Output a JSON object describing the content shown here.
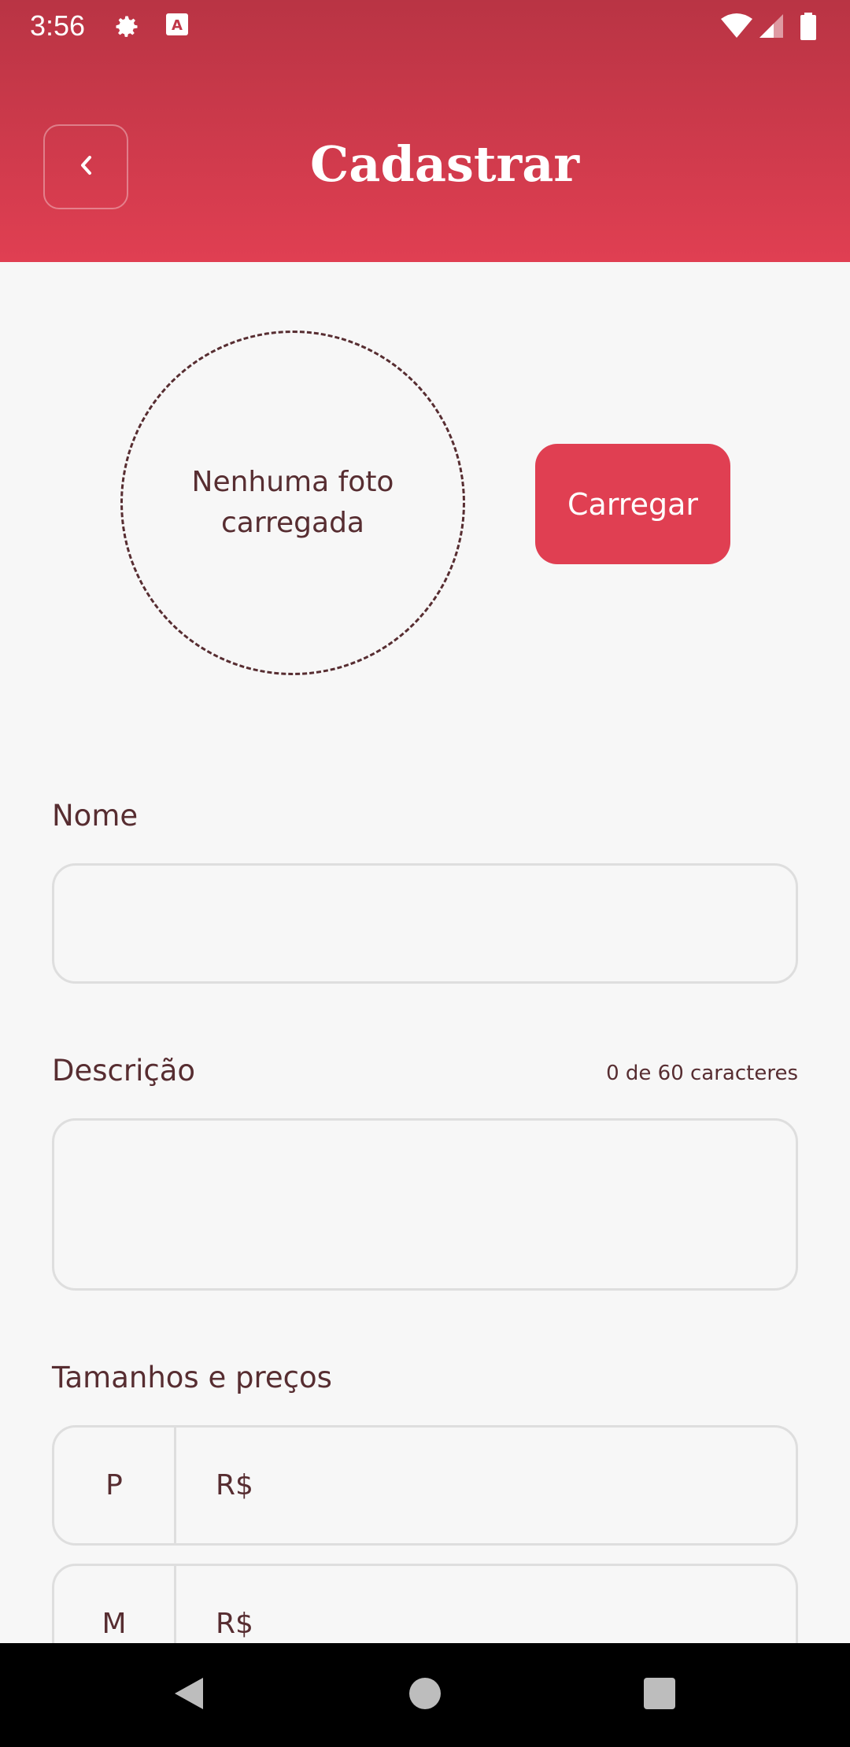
{
  "status_bar": {
    "time": "3:56",
    "icons": [
      "settings-icon",
      "accessibility-a-icon",
      "wifi-icon",
      "cellular-signal-icon",
      "battery-icon"
    ]
  },
  "header": {
    "title": "Cadastrar",
    "back_icon": "chevron-left-icon",
    "gradient_top": "#b93444",
    "gradient_bottom": "#e03f52"
  },
  "photo": {
    "placeholder": "Nenhuma foto carregada",
    "upload_label": "Carregar"
  },
  "form": {
    "name_label": "Nome",
    "name_value": "",
    "description_label": "Descrição",
    "description_counter": "0 de 60 caracteres",
    "description_value": "",
    "sizes_label": "Tamanhos e preços",
    "sizes": [
      {
        "size": "P",
        "currency": "R$"
      },
      {
        "size": "M",
        "currency": "R$"
      }
    ]
  },
  "nav_bar": {
    "icons": [
      "back-triangle-icon",
      "home-circle-icon",
      "recents-square-icon"
    ]
  },
  "colors": {
    "accent": "#e03f52",
    "text": "#572d31",
    "background": "#f7f7f7",
    "border": "#dedede"
  }
}
